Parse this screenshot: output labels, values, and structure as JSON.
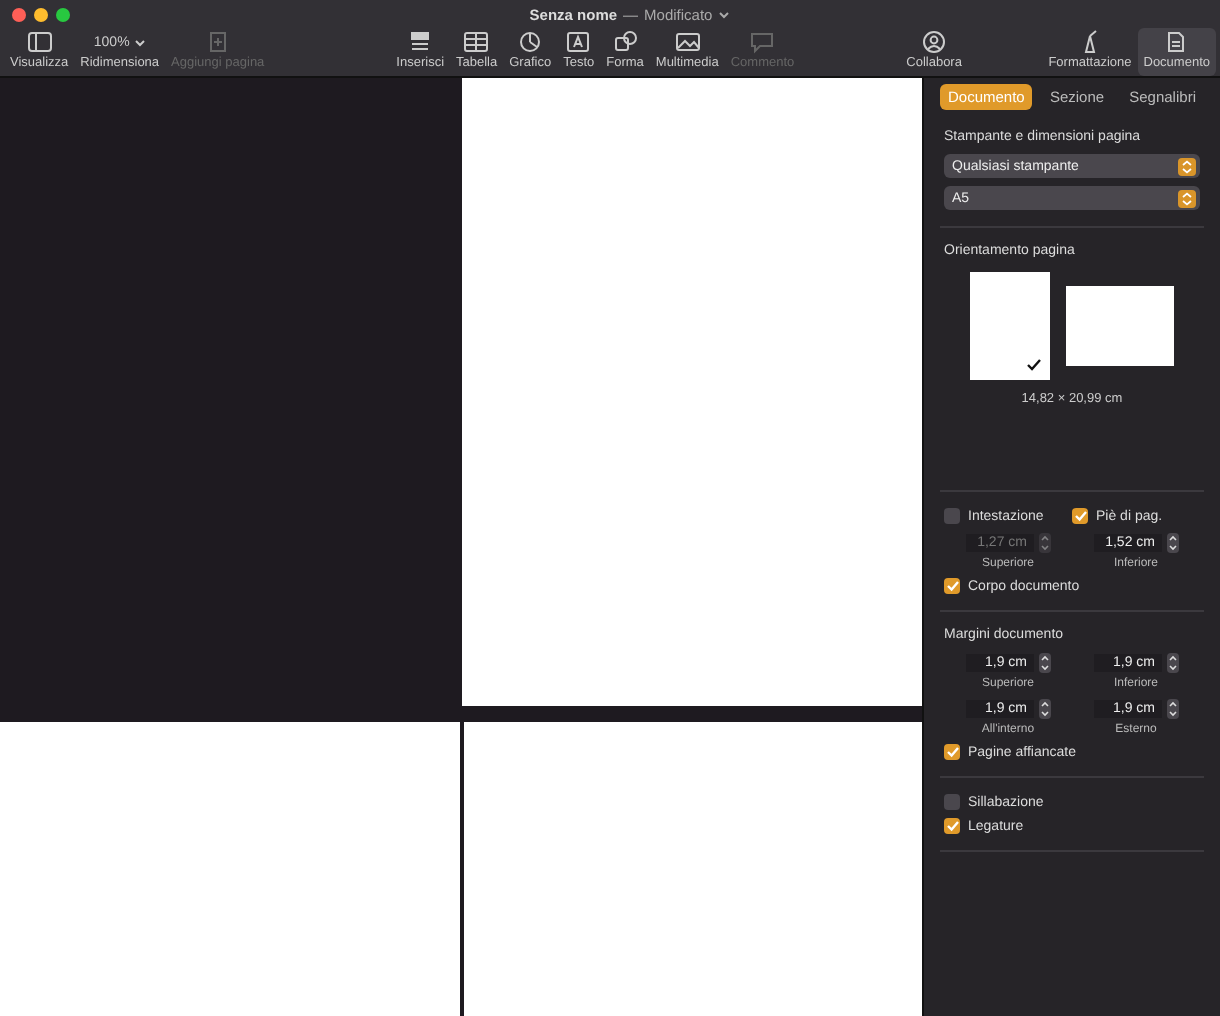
{
  "window": {
    "title": "Senza nome",
    "separator": "—",
    "status": "Modificato"
  },
  "toolbar": {
    "groups": [
      [
        {
          "kind": "sidebar",
          "label": "Visualizza",
          "disabled": false,
          "selected": false
        },
        {
          "kind": "zoom",
          "label": "Ridimensiona",
          "value": "100%",
          "disabled": false,
          "selected": false
        },
        {
          "kind": "addpage",
          "label": "Aggiungi pagina",
          "disabled": true,
          "selected": false
        }
      ],
      [
        {
          "kind": "insert",
          "label": "Inserisci",
          "disabled": false,
          "selected": false
        },
        {
          "kind": "table",
          "label": "Tabella",
          "disabled": false,
          "selected": false
        },
        {
          "kind": "chart",
          "label": "Grafico",
          "disabled": false,
          "selected": false
        },
        {
          "kind": "text",
          "label": "Testo",
          "disabled": false,
          "selected": false
        },
        {
          "kind": "shape",
          "label": "Forma",
          "disabled": false,
          "selected": false
        },
        {
          "kind": "media",
          "label": "Multimedia",
          "disabled": false,
          "selected": false
        },
        {
          "kind": "comment",
          "label": "Commento",
          "disabled": true,
          "selected": false
        }
      ],
      [
        {
          "kind": "collab",
          "label": "Collabora",
          "disabled": false,
          "selected": false
        }
      ],
      [
        {
          "kind": "format",
          "label": "Formattazione",
          "disabled": false,
          "selected": false
        },
        {
          "kind": "document",
          "label": "Documento",
          "disabled": false,
          "selected": true
        }
      ]
    ]
  },
  "sidebar": {
    "tabs": [
      {
        "label": "Documento",
        "selected": true
      },
      {
        "label": "Sezione",
        "selected": false
      },
      {
        "label": "Segnalibri",
        "selected": false
      }
    ],
    "printer": {
      "title": "Stampante e dimensioni pagina",
      "popups": [
        "Qualsiasi stampante",
        "A5"
      ]
    },
    "orientation": {
      "title": "Orientamento pagina",
      "options": [
        {
          "kind": "portrait",
          "selected": true
        },
        {
          "kind": "landscape",
          "selected": false
        }
      ],
      "size": "14,82 × 20,99 cm"
    },
    "header_footer": {
      "checks": [
        {
          "label": "Intestazione",
          "checked": false
        },
        {
          "label": "Piè di pag.",
          "checked": true
        }
      ],
      "steppers": [
        {
          "value": "1,27 cm",
          "caption": "Superiore",
          "disabled": true
        },
        {
          "value": "1,52 cm",
          "caption": "Inferiore",
          "disabled": false
        }
      ],
      "body": {
        "label": "Corpo documento",
        "checked": true
      }
    },
    "margins": {
      "title": "Margini documento",
      "steppers": [
        {
          "value": "1,9 cm",
          "caption": "Superiore",
          "disabled": false
        },
        {
          "value": "1,9 cm",
          "caption": "Inferiore",
          "disabled": false
        },
        {
          "value": "1,9 cm",
          "caption": "All'interno",
          "disabled": false
        },
        {
          "value": "1,9 cm",
          "caption": "Esterno",
          "disabled": false
        }
      ],
      "facing": {
        "label": "Pagine affiancate",
        "checked": true
      }
    },
    "text_options": [
      {
        "label": "Sillabazione",
        "checked": false
      },
      {
        "label": "Legature",
        "checked": true
      }
    ]
  }
}
